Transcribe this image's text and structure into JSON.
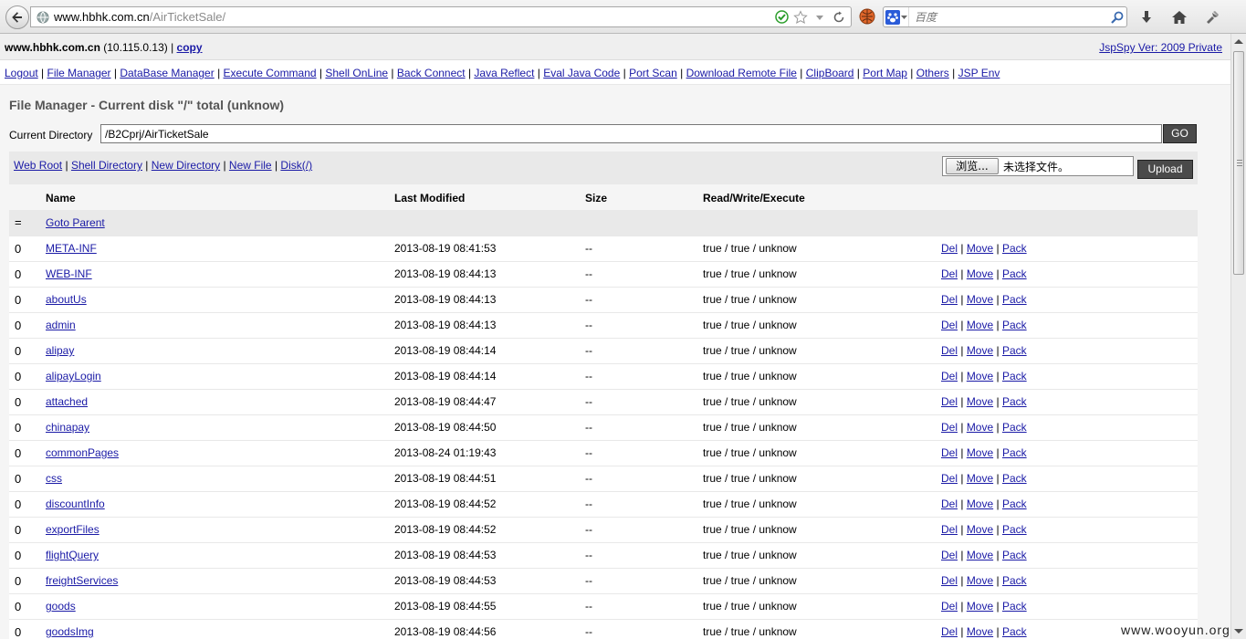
{
  "browser": {
    "url_host": "www.hbhk.com.cn",
    "url_path": "/AirTicketSale/",
    "search_placeholder": "百度",
    "icons": [
      "back-arrow-icon",
      "globe-icon",
      "check-icon",
      "star-icon",
      "dropdown-icon",
      "reload-icon",
      "extension-icon",
      "paw-icon",
      "search-icon",
      "download-icon",
      "home-icon",
      "addon-icon"
    ]
  },
  "header": {
    "host": "www.hbhk.com.cn",
    "ip": "(10.115.0.13)",
    "copy_label": "copy",
    "version": "JspSpy Ver: 2009 Private"
  },
  "menu": [
    "Logout",
    "File Manager",
    "DataBase Manager",
    "Execute Command",
    "Shell OnLine",
    "Back Connect",
    "Java Reflect",
    "Eval Java Code",
    "Port Scan",
    "Download Remote File",
    "ClipBoard",
    "Port Map",
    "Others",
    "JSP Env"
  ],
  "file_manager": {
    "title": "File Manager - Current disk \"/\" total (unknow)",
    "dir_label": "Current Directory",
    "dir_value": "/B2Cprj/AirTicketSale",
    "go_label": "GO",
    "tool_links": [
      "Web Root",
      "Shell Directory",
      "New Directory",
      "New File",
      "Disk(/)"
    ],
    "browse_label": "浏览...",
    "file_status": "未选择文件。",
    "upload_label": "Upload",
    "columns": [
      "Name",
      "Last Modified",
      "Size",
      "Read/Write/Execute"
    ],
    "parent": {
      "flag": "=",
      "label": "Goto Parent"
    },
    "actions": [
      "Del",
      "Move",
      "Pack"
    ],
    "rows": [
      {
        "flag": "0",
        "name": "META-INF",
        "modified": "2013-08-19 08:41:53",
        "size": "--",
        "rwx": "true / true / unknow"
      },
      {
        "flag": "0",
        "name": "WEB-INF",
        "modified": "2013-08-19 08:44:13",
        "size": "--",
        "rwx": "true / true / unknow"
      },
      {
        "flag": "0",
        "name": "aboutUs",
        "modified": "2013-08-19 08:44:13",
        "size": "--",
        "rwx": "true / true / unknow"
      },
      {
        "flag": "0",
        "name": "admin",
        "modified": "2013-08-19 08:44:13",
        "size": "--",
        "rwx": "true / true / unknow"
      },
      {
        "flag": "0",
        "name": "alipay",
        "modified": "2013-08-19 08:44:14",
        "size": "--",
        "rwx": "true / true / unknow"
      },
      {
        "flag": "0",
        "name": "alipayLogin",
        "modified": "2013-08-19 08:44:14",
        "size": "--",
        "rwx": "true / true / unknow"
      },
      {
        "flag": "0",
        "name": "attached",
        "modified": "2013-08-19 08:44:47",
        "size": "--",
        "rwx": "true / true / unknow"
      },
      {
        "flag": "0",
        "name": "chinapay",
        "modified": "2013-08-19 08:44:50",
        "size": "--",
        "rwx": "true / true / unknow"
      },
      {
        "flag": "0",
        "name": "commonPages",
        "modified": "2013-08-24 01:19:43",
        "size": "--",
        "rwx": "true / true / unknow"
      },
      {
        "flag": "0",
        "name": "css",
        "modified": "2013-08-19 08:44:51",
        "size": "--",
        "rwx": "true / true / unknow"
      },
      {
        "flag": "0",
        "name": "discountInfo",
        "modified": "2013-08-19 08:44:52",
        "size": "--",
        "rwx": "true / true / unknow"
      },
      {
        "flag": "0",
        "name": "exportFiles",
        "modified": "2013-08-19 08:44:52",
        "size": "--",
        "rwx": "true / true / unknow"
      },
      {
        "flag": "0",
        "name": "flightQuery",
        "modified": "2013-08-19 08:44:53",
        "size": "--",
        "rwx": "true / true / unknow"
      },
      {
        "flag": "0",
        "name": "freightServices",
        "modified": "2013-08-19 08:44:53",
        "size": "--",
        "rwx": "true / true / unknow"
      },
      {
        "flag": "0",
        "name": "goods",
        "modified": "2013-08-19 08:44:55",
        "size": "--",
        "rwx": "true / true / unknow"
      },
      {
        "flag": "0",
        "name": "goodsImg",
        "modified": "2013-08-19 08:44:56",
        "size": "--",
        "rwx": "true / true / unknow"
      }
    ]
  },
  "watermark": "www.wooyun.org",
  "colors": {
    "link": "#1a1aa6",
    "button_dark": "#4a4a4a",
    "panel": "#f5f5f5"
  }
}
